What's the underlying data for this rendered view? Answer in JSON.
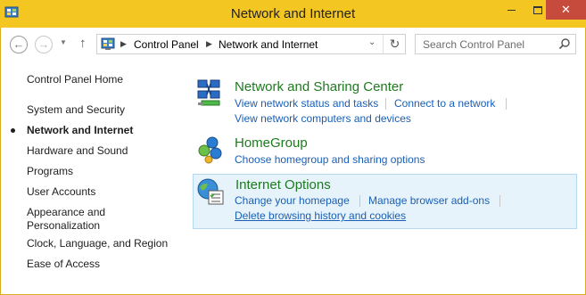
{
  "window": {
    "title": "Network and Internet",
    "close_glyph": "✕"
  },
  "nav": {
    "back_glyph": "←",
    "forward_glyph": "→",
    "history_glyph": "▼",
    "up_glyph": "↑"
  },
  "address": {
    "crumbs": [
      "Control Panel",
      "Network and Internet"
    ],
    "separator_glyph": "▶",
    "dropdown_glyph": "⌄",
    "refresh_glyph": "↻"
  },
  "search": {
    "placeholder": "Search Control Panel"
  },
  "sidebar": {
    "items": [
      {
        "label": "Control Panel Home"
      },
      {
        "label": "System and Security"
      },
      {
        "label": "Network and Internet",
        "current": true
      },
      {
        "label": "Hardware and Sound"
      },
      {
        "label": "Programs"
      },
      {
        "label": "User Accounts"
      },
      {
        "label": "Appearance and",
        "label2": "Personalization"
      },
      {
        "label": "Clock, Language, and Region"
      },
      {
        "label": "Ease of Access"
      }
    ]
  },
  "categories": [
    {
      "title": "Network and Sharing Center",
      "icon": "network-sharing-center-icon",
      "tasks": [
        "View network status and tasks",
        "Connect to a network",
        "View network computers and devices"
      ]
    },
    {
      "title": "HomeGroup",
      "icon": "homegroup-icon",
      "tasks": [
        "Choose homegroup and sharing options"
      ]
    },
    {
      "title": "Internet Options",
      "icon": "internet-options-icon",
      "tasks": [
        "Change your homepage",
        "Manage browser add-ons",
        "Delete browsing history and cookies"
      ]
    }
  ],
  "colors": {
    "titlebar": "#f3c622",
    "close_button": "#c74b3c",
    "category_title": "#1e7a1e",
    "task_link": "#1a5fb4",
    "highlight_bg": "#e6f3fb"
  }
}
